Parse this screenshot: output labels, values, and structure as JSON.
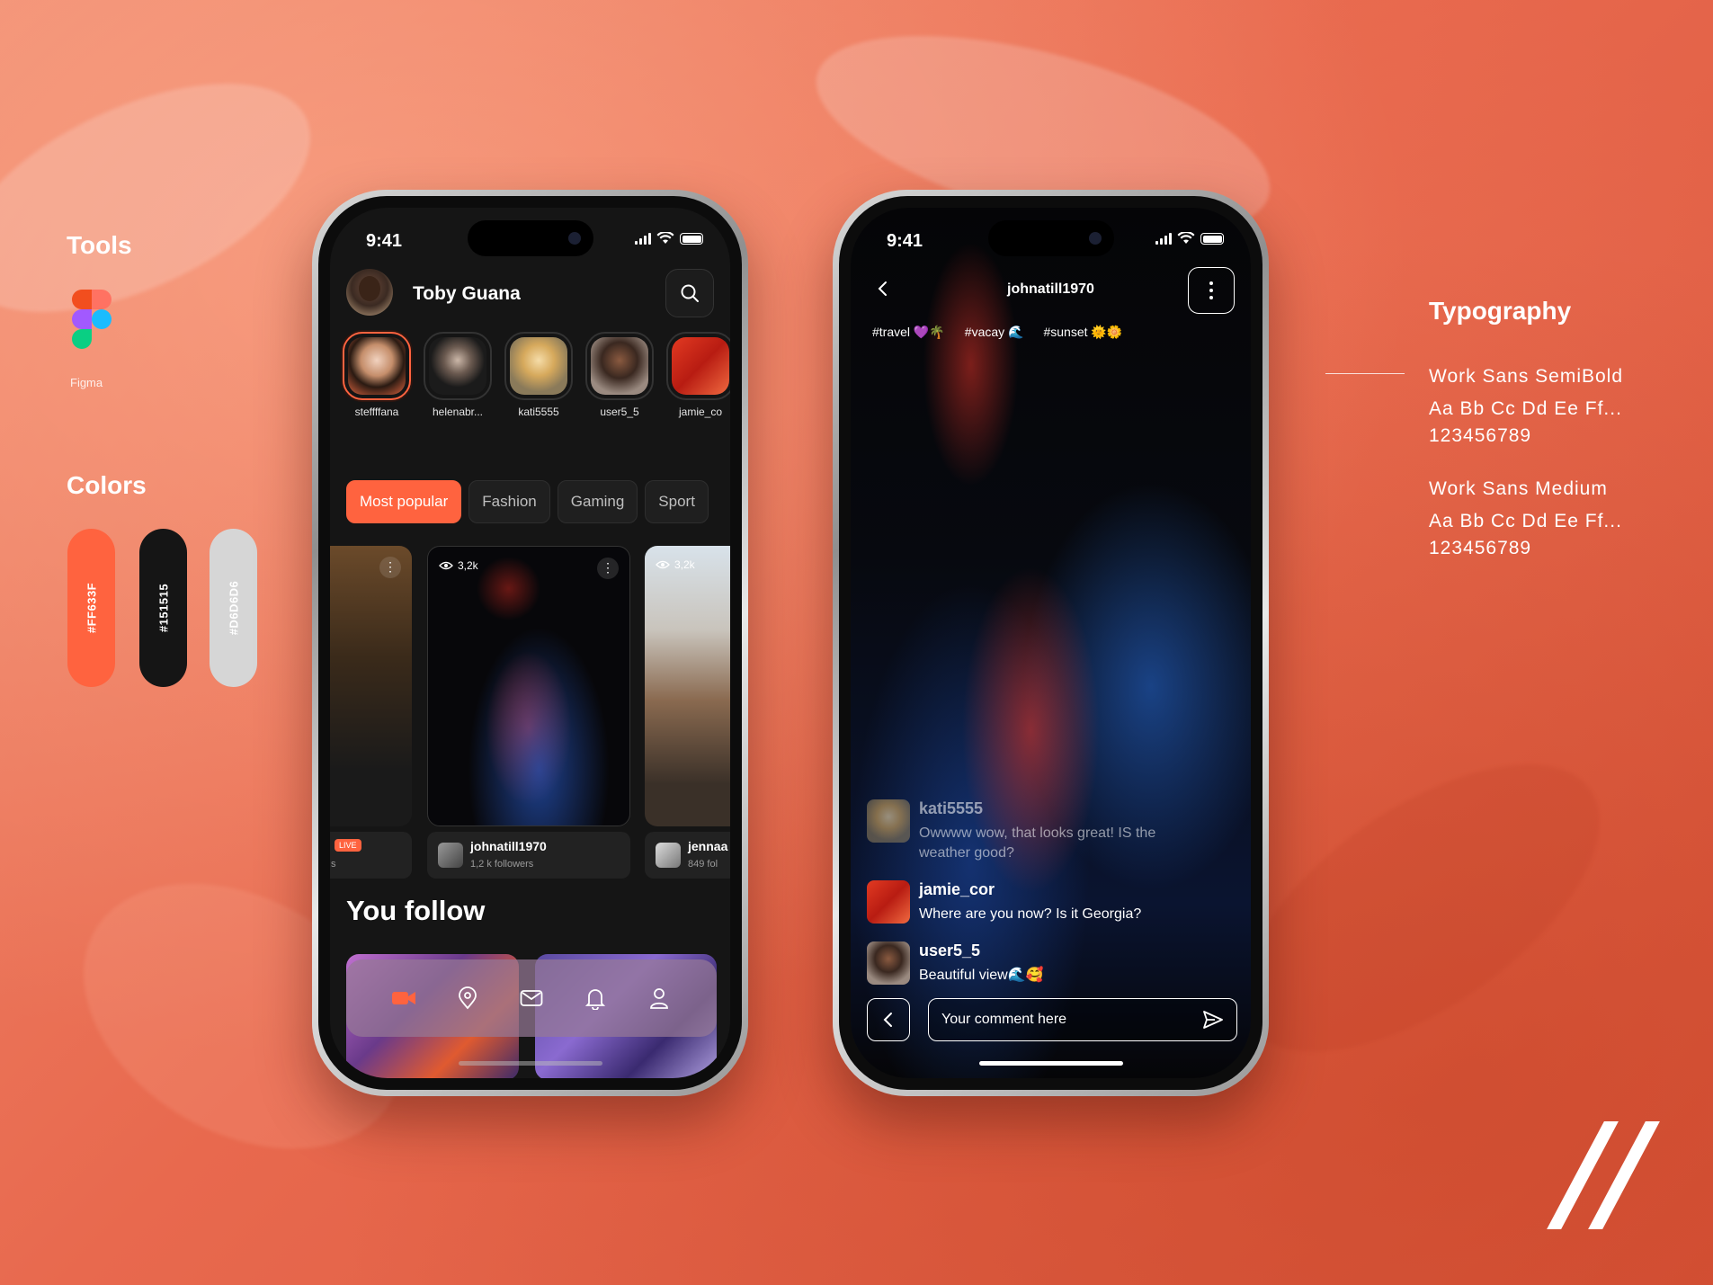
{
  "tools": {
    "title": "Tools",
    "figma_label": "Figma"
  },
  "colors": {
    "title": "Colors",
    "swatches": [
      {
        "label": "#FF633F",
        "hex": "#FF633F"
      },
      {
        "label": "#151515",
        "hex": "#151515"
      },
      {
        "label": "#D6D6D6",
        "hex": "#D6D6D6"
      }
    ]
  },
  "typography": {
    "title": "Typography",
    "font1_name": "Work Sans SemiBold",
    "font1_sample": "Aa Bb Cc Dd Ee Ff...",
    "font1_digits": "123456789",
    "font2_name": "Work Sans Medium",
    "font2_sample": "Aa Bb Cc Dd Ee Ff...",
    "font2_digits": "123456789"
  },
  "phone_home": {
    "time": "9:41",
    "user_name": "Toby Guana",
    "stories": [
      "steffffana",
      "helenabr...",
      "kati5555",
      "user5_5",
      "jamie_co"
    ],
    "chips": [
      "Most popular",
      "Fashion",
      "Gaming",
      "Sport"
    ],
    "cards": [
      {
        "badge": "LIVE",
        "followers": "s"
      },
      {
        "views": "3,2k",
        "username": "johnatill1970",
        "followers": "1,2 k followers"
      },
      {
        "views": "3,2k",
        "username": "jennaa",
        "followers": "849 fol"
      }
    ],
    "section_title": "You follow",
    "tabbar_icons": [
      "video-icon",
      "location-icon",
      "mail-icon",
      "bell-icon",
      "profile-icon"
    ]
  },
  "phone_stream": {
    "time": "9:41",
    "username": "johnatill1970",
    "tags": [
      "#travel 💜🌴",
      "#vacay 🌊",
      "#sunset 🌞🌼"
    ],
    "comments": [
      {
        "user": "kati5555",
        "text": "Owwww wow, that looks great! IS the weather good?"
      },
      {
        "user": "jamie_cor",
        "text": "Where are you now? Is it Georgia?"
      },
      {
        "user": "user5_5",
        "text": "Beautiful view🌊🥰"
      }
    ],
    "comment_placeholder": "Your comment here"
  }
}
